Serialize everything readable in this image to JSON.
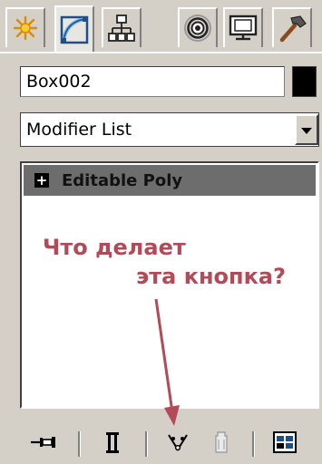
{
  "tabs": [
    {
      "icon": "create-icon",
      "active": false
    },
    {
      "icon": "modify-icon",
      "active": true
    },
    {
      "icon": "hierarchy-icon",
      "active": false
    },
    {
      "icon": "motion-icon",
      "active": false
    },
    {
      "icon": "display-icon",
      "active": false
    },
    {
      "icon": "utilities-icon",
      "active": false
    }
  ],
  "object": {
    "name": "Box002",
    "color": "#000000"
  },
  "modifier_list": {
    "label": "Modifier List"
  },
  "stack": {
    "items": [
      {
        "label": "Editable Poly",
        "expand_symbol": "+"
      }
    ]
  },
  "annotation": {
    "line1": "Что делает",
    "line2": "эта кнопка?",
    "color": "#b24a57"
  },
  "toolbar": {
    "buttons": [
      {
        "icon": "pin-stack-icon"
      },
      {
        "icon": "show-end-result-icon"
      },
      {
        "icon": "make-unique-icon"
      },
      {
        "icon": "remove-modifier-icon"
      },
      {
        "icon": "configure-modifier-sets-icon"
      }
    ]
  }
}
